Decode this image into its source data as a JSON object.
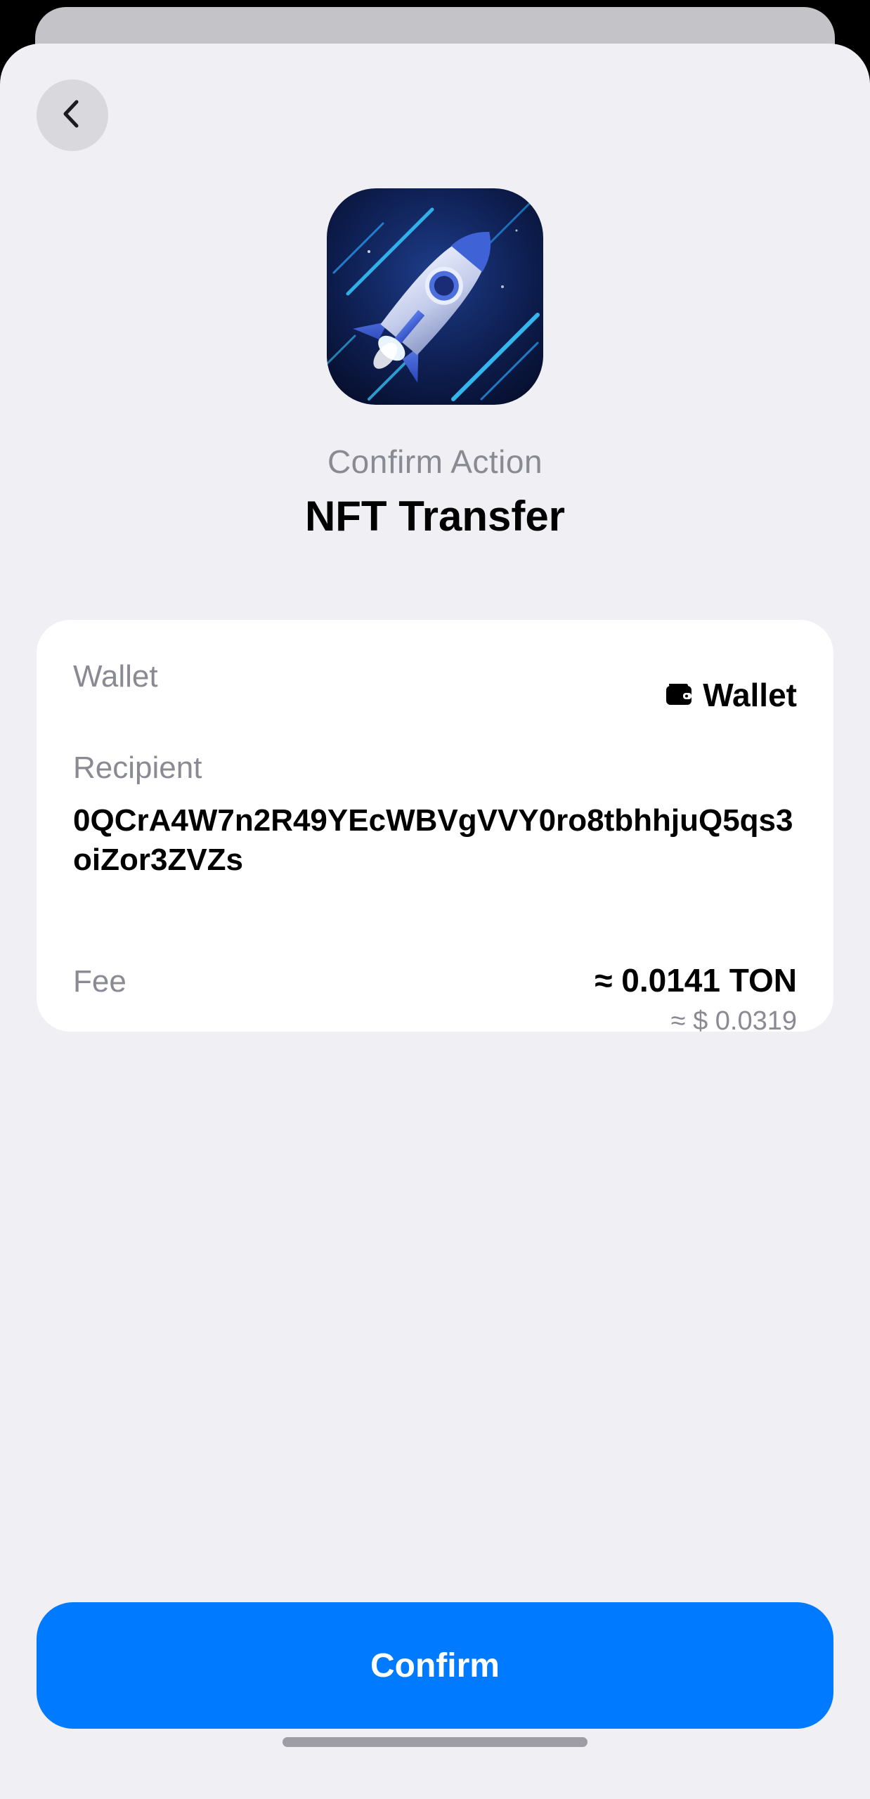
{
  "header": {
    "subtitle": "Confirm Action",
    "title": "NFT Transfer",
    "back_icon": "chevron-left-icon"
  },
  "details": {
    "wallet": {
      "label": "Wallet",
      "value": "Wallet",
      "icon": "wallet-icon"
    },
    "recipient": {
      "label": "Recipient",
      "address": "0QCrA4W7n2R49YEcWBVgVVY0ro8tbhhjuQ5qs3oiZor3ZVZs"
    },
    "fee": {
      "label": "Fee",
      "amount": "≈ 0.0141 TON",
      "fiat": "≈ $ 0.0319"
    }
  },
  "actions": {
    "confirm_label": "Confirm"
  },
  "colors": {
    "accent": "#007aff",
    "background": "#efeff4",
    "card": "#ffffff",
    "secondary_text": "#8a8a93"
  }
}
